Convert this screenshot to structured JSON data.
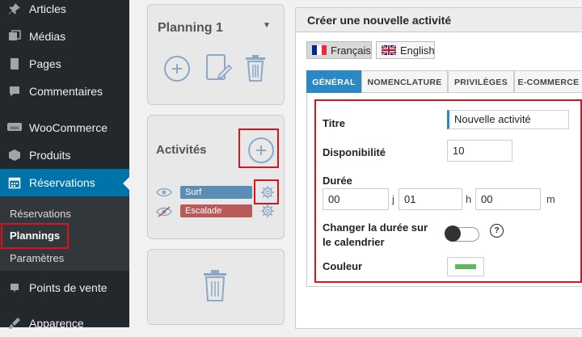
{
  "sidebar": {
    "items": [
      {
        "label": "Articles",
        "icon": "pin-icon"
      },
      {
        "label": "Médias",
        "icon": "media-icon"
      },
      {
        "label": "Pages",
        "icon": "pages-icon"
      },
      {
        "label": "Commentaires",
        "icon": "comment-icon"
      },
      {
        "label": "WooCommerce",
        "icon": "woocommerce-icon"
      },
      {
        "label": "Produits",
        "icon": "box-icon"
      },
      {
        "label": "Réservations",
        "icon": "calendar-icon"
      },
      {
        "label": "Points de vente",
        "icon": "location-icon"
      },
      {
        "label": "Apparence",
        "icon": "brush-icon"
      }
    ],
    "submenu": [
      "Réservations",
      "Plannings",
      "Paramètres"
    ]
  },
  "middle": {
    "planning_title": "Planning 1",
    "activities_title": "Activités",
    "activities": [
      {
        "label": "Surf",
        "color": "#5b8db5"
      },
      {
        "label": "Escalade",
        "color": "#b85a5a"
      }
    ]
  },
  "main": {
    "title": "Créer une nouvelle activité",
    "languages": [
      {
        "label": "Français",
        "selected": true
      },
      {
        "label": "English",
        "selected": false
      }
    ],
    "tabs": [
      "GÉNÉRAL",
      "NOMENCLATURE",
      "PRIVILÈGES",
      "E-COMMERCE"
    ],
    "form": {
      "title_label": "Titre",
      "title_value": "Nouvelle activité",
      "availability_label": "Disponibilité",
      "availability_value": "10",
      "duration_label": "Durée",
      "duration_days": "00",
      "duration_hours": "01",
      "duration_minutes": "00",
      "unit_days": "j",
      "unit_hours": "h",
      "unit_minutes": "m",
      "calendar_label_line1": "Changer la durée sur",
      "calendar_label_line2": "le calendrier",
      "help_symbol": "?",
      "color_label": "Couleur",
      "color_value": "#5cb85c"
    }
  },
  "colors": {
    "highlight": "#d9141c",
    "accent": "#0073aa",
    "tab_active": "#2a88c5"
  }
}
